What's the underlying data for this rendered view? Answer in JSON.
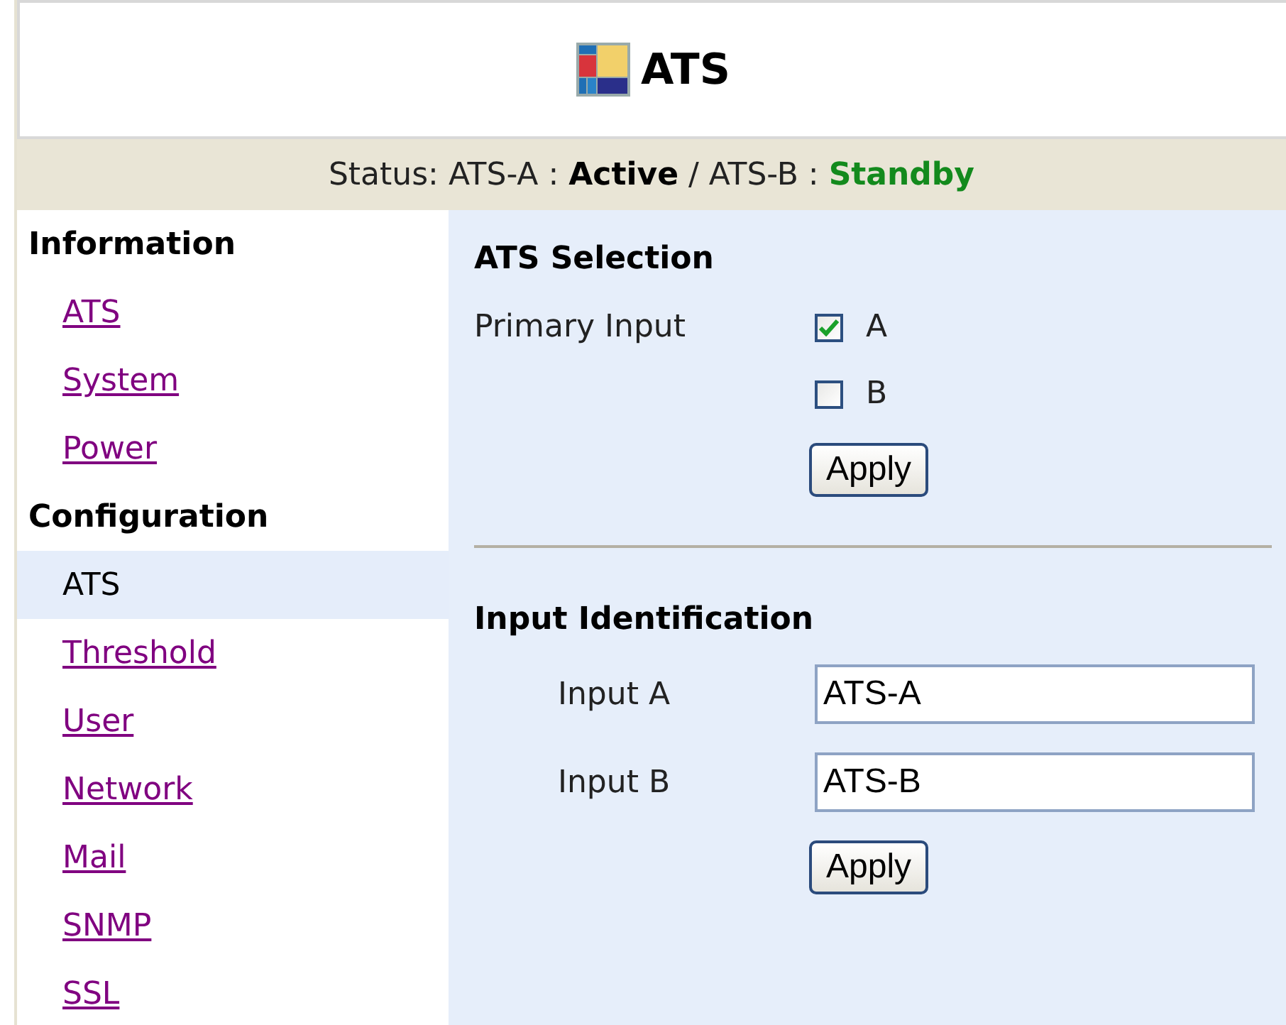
{
  "header": {
    "title": "ATS"
  },
  "status": "Status: ATS-A : **Active** / ATS-B : **Standby**",
  "sidebar": [
    {
      "heading": "Information",
      "items": [
        {
          "label": "ATS",
          "selected": false
        },
        {
          "label": "System",
          "selected": false
        },
        {
          "label": "Power",
          "selected": false
        }
      ]
    },
    {
      "heading": "Configuration",
      "items": [
        {
          "label": "ATS",
          "selected": true
        },
        {
          "label": "Threshold",
          "selected": false
        },
        {
          "label": "User",
          "selected": false
        },
        {
          "label": "Network",
          "selected": false
        },
        {
          "label": "Mail",
          "selected": false
        },
        {
          "label": "SNMP",
          "selected": false
        },
        {
          "label": "SSL",
          "selected": false
        }
      ]
    }
  ],
  "selection": {
    "title": "ATS Selection",
    "label": "Primary Input",
    "options": [
      {
        "label": "A",
        "checked": true
      },
      {
        "label": "B",
        "checked": false
      }
    ],
    "button": "Apply"
  },
  "identification": {
    "title": "Input Identification",
    "fields": [
      {
        "label": "Input A",
        "value": "ATS-A"
      },
      {
        "label": "Input B",
        "value": "ATS-B"
      }
    ],
    "button": "Apply"
  }
}
